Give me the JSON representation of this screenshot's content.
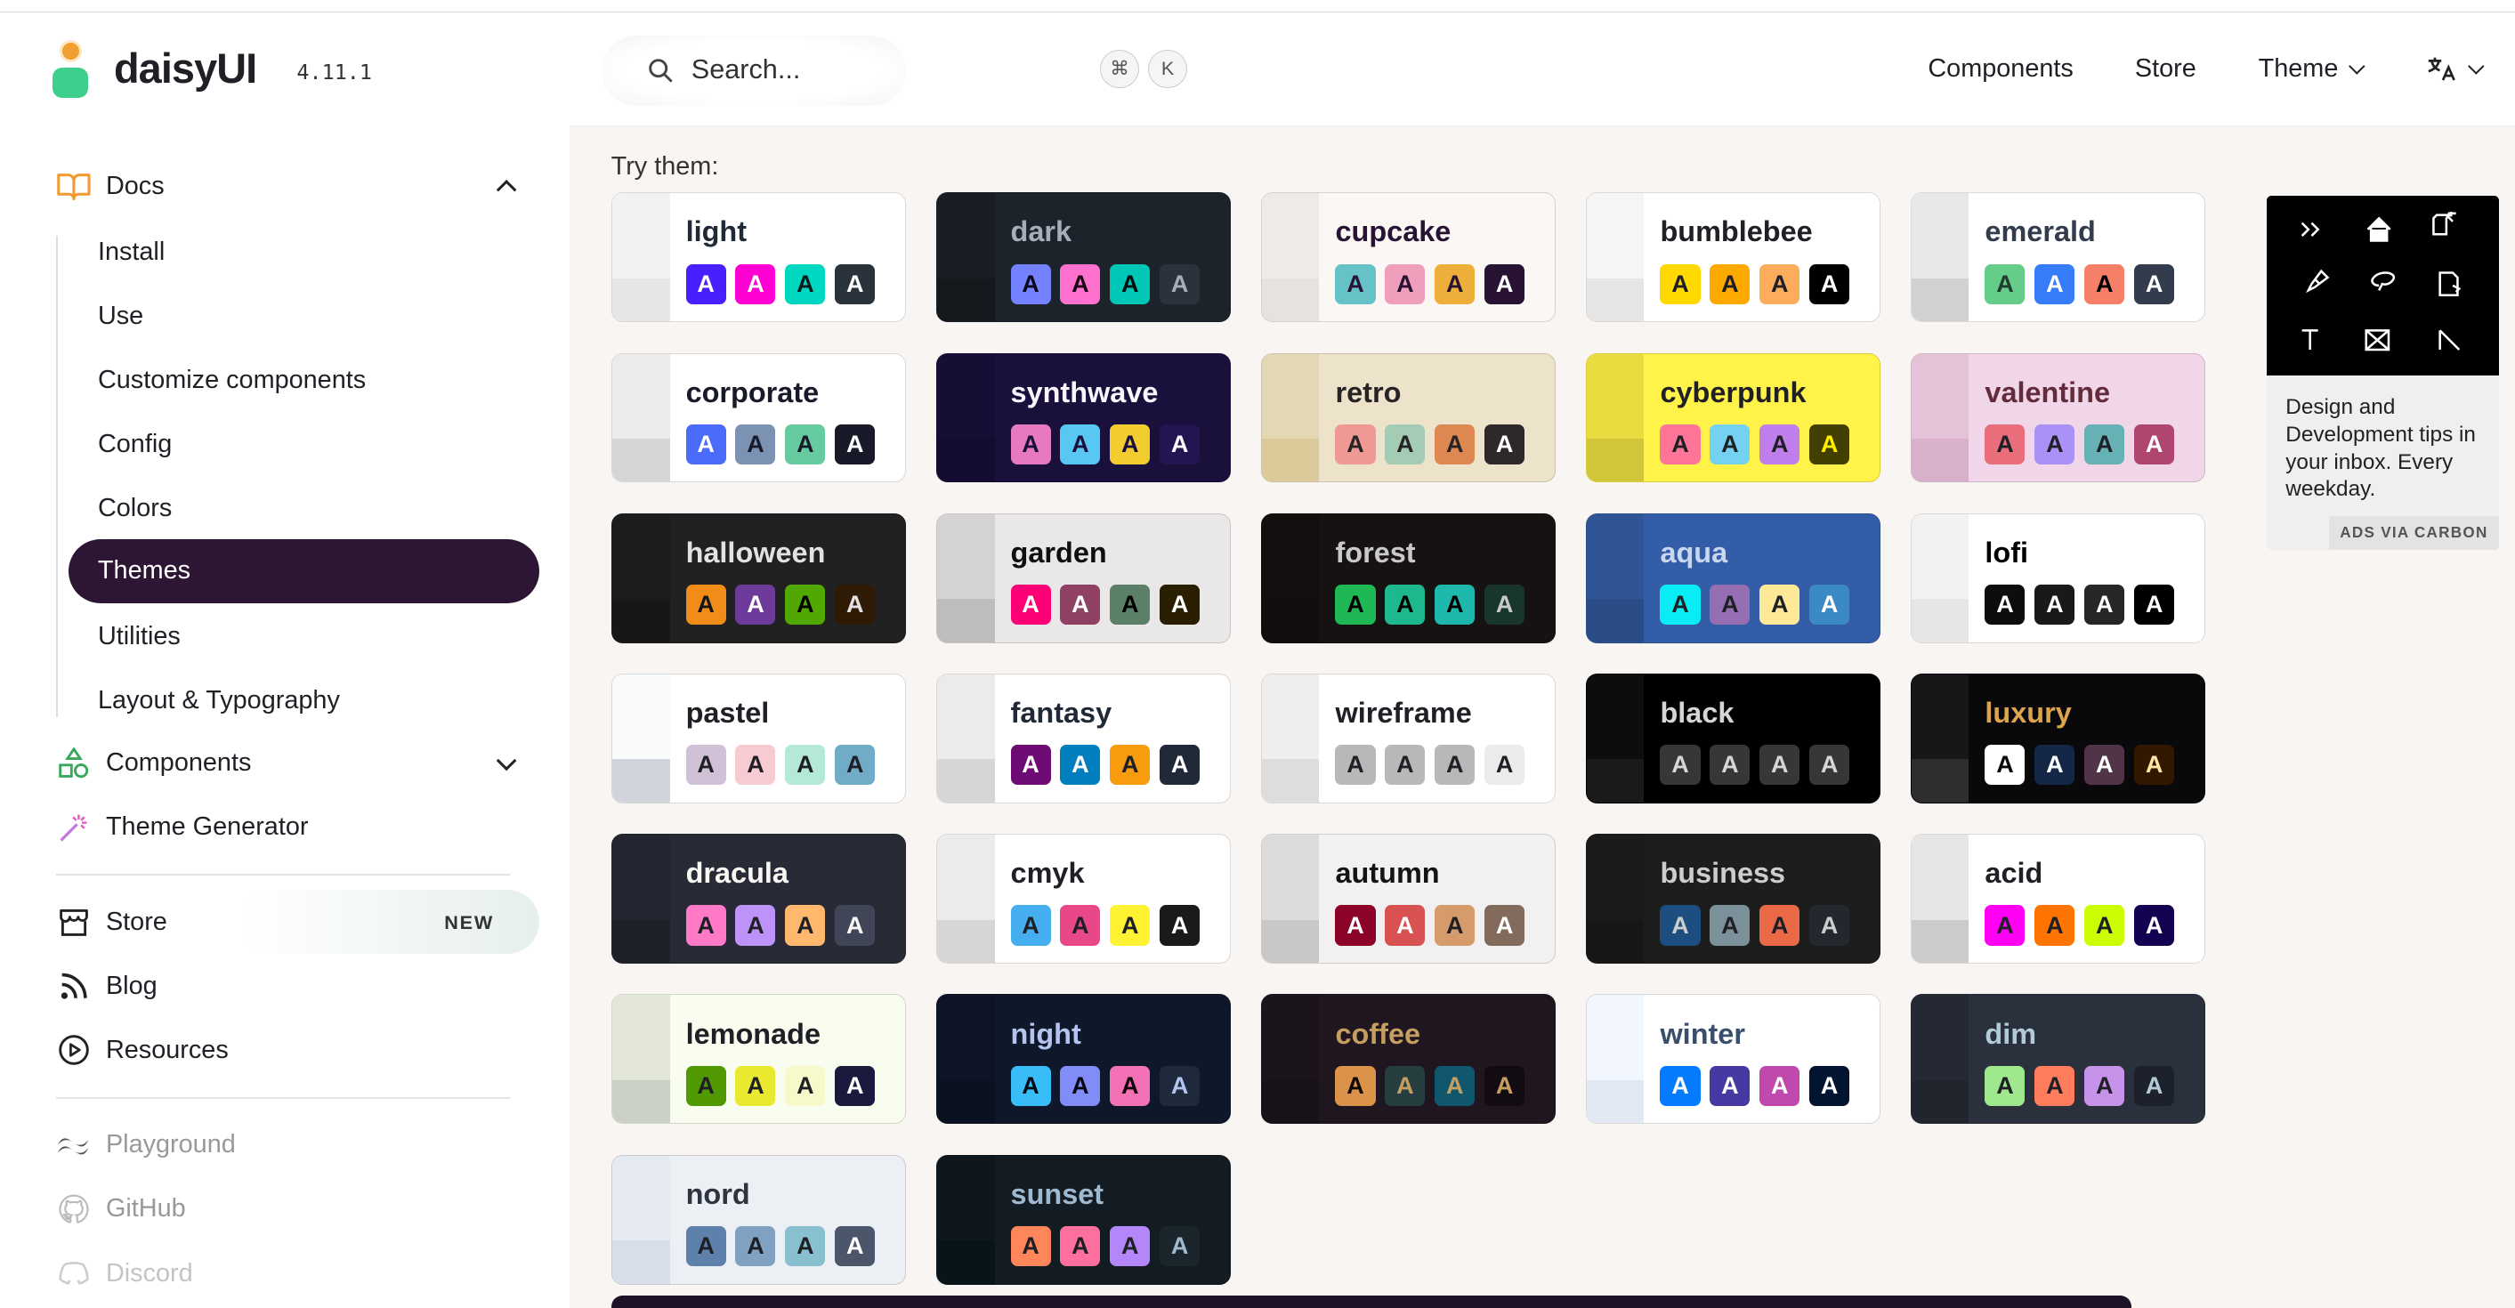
{
  "brand": {
    "name": "daisyUI",
    "version": "4.11.1"
  },
  "header": {
    "search_placeholder": "Search...",
    "kbd_cmd": "⌘",
    "kbd_k": "K",
    "links": {
      "components": "Components",
      "store": "Store",
      "theme": "Theme"
    }
  },
  "sidebar": {
    "docs": "Docs",
    "docs_items": [
      "Install",
      "Use",
      "Customize components",
      "Config",
      "Colors",
      "Themes",
      "Utilities",
      "Layout & Typography"
    ],
    "components": "Components",
    "theme_generator": "Theme Generator",
    "store": "Store",
    "store_badge": "NEW",
    "blog": "Blog",
    "resources": "Resources",
    "playground": "Playground",
    "github": "GitHub",
    "discord": "Discord"
  },
  "main": {
    "try_label": "Try them:"
  },
  "themes": [
    {
      "name": "light",
      "bg": "#ffffff",
      "s1": "#f2f2f2",
      "s2": "#e5e6e6",
      "fg": "#1f2937",
      "sw": [
        [
          "#491eff",
          "#fff"
        ],
        [
          "#ff00d3",
          "#fff"
        ],
        [
          "#00d7c0",
          "#0b1a18"
        ],
        [
          "#2a323c",
          "#fff"
        ]
      ]
    },
    {
      "name": "dark",
      "bg": "#1d232a",
      "s1": "#191e24",
      "s2": "#15191e",
      "fg": "#a6adbb",
      "sw": [
        [
          "#7582ff",
          "#050617"
        ],
        [
          "#ff71cf",
          "#190211"
        ],
        [
          "#00c7b5",
          "#000e0c"
        ],
        [
          "#2a323c",
          "#a6adbb"
        ]
      ]
    },
    {
      "name": "cupcake",
      "bg": "#faf7f5",
      "s1": "#efeae6",
      "s2": "#e7e2df",
      "fg": "#291334",
      "sw": [
        [
          "#65c3c8",
          "#291334"
        ],
        [
          "#ef9fbc",
          "#291334"
        ],
        [
          "#eeaf3a",
          "#291334"
        ],
        [
          "#291334",
          "#fff"
        ]
      ]
    },
    {
      "name": "bumblebee",
      "bg": "#ffffff",
      "s1": "#f5f5f5",
      "s2": "#e5e5e5",
      "fg": "#1f1f26",
      "sw": [
        [
          "#ffd900",
          "#1f1f26"
        ],
        [
          "#ffa800",
          "#1f1f26"
        ],
        [
          "#fbad5c",
          "#1f1f26"
        ],
        [
          "#000000",
          "#fff"
        ]
      ]
    },
    {
      "name": "emerald",
      "bg": "#ffffff",
      "s1": "#e8e8e8",
      "s2": "#d1d1d1",
      "fg": "#333c4d",
      "sw": [
        [
          "#66cc8a",
          "#223d30"
        ],
        [
          "#377cfb",
          "#fff"
        ],
        [
          "#f68067",
          "#000"
        ],
        [
          "#333c4d",
          "#fff"
        ]
      ]
    },
    {
      "name": "corporate",
      "bg": "#ffffff",
      "s1": "#ebebeb",
      "s2": "#d6d6d6",
      "fg": "#181a2a",
      "sw": [
        [
          "#4b6bfb",
          "#fff"
        ],
        [
          "#7b92b2",
          "#181a2a"
        ],
        [
          "#67cba0",
          "#181a2a"
        ],
        [
          "#181a2a",
          "#fff"
        ]
      ]
    },
    {
      "name": "synthwave",
      "bg": "#1a103c",
      "s1": "#170e36",
      "s2": "#140c30",
      "fg": "#f9f7fd",
      "sw": [
        [
          "#e779c1",
          "#1a103c"
        ],
        [
          "#58c7f3",
          "#1a103c"
        ],
        [
          "#f3cc30",
          "#1a103c"
        ],
        [
          "#221551",
          "#f9f7fd"
        ]
      ]
    },
    {
      "name": "retro",
      "bg": "#ece3ca",
      "s1": "#e4d8b4",
      "s2": "#dbca9a",
      "fg": "#282425",
      "sw": [
        [
          "#ef9995",
          "#282425"
        ],
        [
          "#a4cbb4",
          "#282425"
        ],
        [
          "#dc8850",
          "#282425"
        ],
        [
          "#2e282a",
          "#fff"
        ]
      ]
    },
    {
      "name": "cyberpunk",
      "bg": "#fff248",
      "s1": "#e8dc41",
      "s2": "#d1c63a",
      "fg": "#1f1f26",
      "sw": [
        [
          "#ff7598",
          "#1f1f26"
        ],
        [
          "#75d1f0",
          "#1f1f26"
        ],
        [
          "#c07eec",
          "#1f1f26"
        ],
        [
          "#423f00",
          "#ffee00"
        ]
      ]
    },
    {
      "name": "valentine",
      "bg": "#f0d6e8",
      "s1": "#e4c3d9",
      "s2": "#d9b0cb",
      "fg": "#632c3b",
      "sw": [
        [
          "#e96d7b",
          "#1f1f26"
        ],
        [
          "#a991f7",
          "#1f1f26"
        ],
        [
          "#66b1b3",
          "#1f1f26"
        ],
        [
          "#af4670",
          "#fff"
        ]
      ]
    },
    {
      "name": "halloween",
      "bg": "#212121",
      "s1": "#1c1c1c",
      "s2": "#171717",
      "fg": "#e2e2e2",
      "sw": [
        [
          "#f28c18",
          "#131616"
        ],
        [
          "#6d3a9c",
          "#fff"
        ],
        [
          "#51a800",
          "#000"
        ],
        [
          "#2f1b05",
          "#e2e2e2"
        ]
      ]
    },
    {
      "name": "garden",
      "bg": "#e9e7e7",
      "s1": "#d4d2d2",
      "s2": "#bfbcbc",
      "fg": "#100f0f",
      "sw": [
        [
          "#fe0075",
          "#fff"
        ],
        [
          "#8e4162",
          "#fff"
        ],
        [
          "#5c7f67",
          "#000"
        ],
        [
          "#291e00",
          "#fff"
        ]
      ]
    },
    {
      "name": "forest",
      "bg": "#171212",
      "s1": "#140f0f",
      "s2": "#110d0d",
      "fg": "#cac9c9",
      "sw": [
        [
          "#1eb854",
          "#000"
        ],
        [
          "#1db88e",
          "#000"
        ],
        [
          "#1db8ab",
          "#000"
        ],
        [
          "#19362d",
          "#cac9c9"
        ]
      ]
    },
    {
      "name": "aqua",
      "bg": "#345da7",
      "s1": "#2f5596",
      "s2": "#2a4c87",
      "fg": "#c8d6f0",
      "sw": [
        [
          "#09ecf3",
          "#1f1f26"
        ],
        [
          "#966fb3",
          "#1f1f26"
        ],
        [
          "#ffe999",
          "#1f1f26"
        ],
        [
          "#3b8ac4",
          "#fff"
        ]
      ]
    },
    {
      "name": "lofi",
      "bg": "#ffffff",
      "s1": "#f2f2f2",
      "s2": "#e6e6e6",
      "fg": "#000",
      "sw": [
        [
          "#0d0d0d",
          "#fff"
        ],
        [
          "#1a1919",
          "#fff"
        ],
        [
          "#262626",
          "#fff"
        ],
        [
          "#000000",
          "#fff"
        ]
      ]
    },
    {
      "name": "pastel",
      "bg": "#ffffff",
      "s1": "#f9fafb",
      "s2": "#d1d5db",
      "fg": "#1f1f26",
      "sw": [
        [
          "#d1c1d7",
          "#1f1f26"
        ],
        [
          "#f6cbd1",
          "#1f1f26"
        ],
        [
          "#b4e9d6",
          "#1f1f26"
        ],
        [
          "#70acc7",
          "#1f1f26"
        ]
      ]
    },
    {
      "name": "fantasy",
      "bg": "#ffffff",
      "s1": "#ebebeb",
      "s2": "#d6d6d6",
      "fg": "#1f2937",
      "sw": [
        [
          "#6e0b75",
          "#fff"
        ],
        [
          "#007ebd",
          "#fff"
        ],
        [
          "#f89c0e",
          "#1f1f26"
        ],
        [
          "#1f2937",
          "#fff"
        ]
      ]
    },
    {
      "name": "wireframe",
      "bg": "#ffffff",
      "s1": "#eeeeee",
      "s2": "#dddddd",
      "fg": "#1f1f26",
      "sw": [
        [
          "#b8b8b8",
          "#1f1f26"
        ],
        [
          "#b8b8b8",
          "#1f1f26"
        ],
        [
          "#b8b8b8",
          "#1f1f26"
        ],
        [
          "#ebebeb",
          "#1f1f26"
        ]
      ]
    },
    {
      "name": "black",
      "bg": "#000000",
      "s1": "#0d0d0d",
      "s2": "#1a1a1a",
      "fg": "#d6d6d6",
      "sw": [
        [
          "#373737",
          "#d6d6d6"
        ],
        [
          "#373737",
          "#d6d6d6"
        ],
        [
          "#373737",
          "#d6d6d6"
        ],
        [
          "#373737",
          "#d6d6d6"
        ]
      ]
    },
    {
      "name": "luxury",
      "bg": "#09090b",
      "s1": "#171618",
      "s2": "#2e2d2f",
      "fg": "#dca54c",
      "sw": [
        [
          "#ffffff",
          "#09090b"
        ],
        [
          "#152747",
          "#fff"
        ],
        [
          "#513448",
          "#fff"
        ],
        [
          "#331800",
          "#ffe7a3"
        ]
      ]
    },
    {
      "name": "dracula",
      "bg": "#282a36",
      "s1": "#232530",
      "s2": "#1e2029",
      "fg": "#f8f8f2",
      "sw": [
        [
          "#ff79c6",
          "#1f1f26"
        ],
        [
          "#bd93f9",
          "#1f1f26"
        ],
        [
          "#ffb86c",
          "#1f1f26"
        ],
        [
          "#414558",
          "#f8f8f2"
        ]
      ]
    },
    {
      "name": "cmyk",
      "bg": "#ffffff",
      "s1": "#ebebeb",
      "s2": "#d6d6d6",
      "fg": "#1f1f26",
      "sw": [
        [
          "#45aeee",
          "#1f1f26"
        ],
        [
          "#e8488a",
          "#1f1f26"
        ],
        [
          "#fff232",
          "#1f1f26"
        ],
        [
          "#1a1a1a",
          "#fff"
        ]
      ]
    },
    {
      "name": "autumn",
      "bg": "#f1f1f1",
      "s1": "#dcdcdc",
      "s2": "#c8c8c8",
      "fg": "#141414",
      "sw": [
        [
          "#8c0327",
          "#fff"
        ],
        [
          "#d85251",
          "#fff"
        ],
        [
          "#d59b6a",
          "#1f1f26"
        ],
        [
          "#826a5c",
          "#fff"
        ]
      ]
    },
    {
      "name": "business",
      "bg": "#1d1d1d",
      "s1": "#1a1a1a",
      "s2": "#171717",
      "fg": "#cdcdcd",
      "sw": [
        [
          "#1c4e80",
          "#cdcdcd"
        ],
        [
          "#7c909a",
          "#1f1f26"
        ],
        [
          "#ea6947",
          "#1f1f26"
        ],
        [
          "#23282e",
          "#cdcdcd"
        ]
      ]
    },
    {
      "name": "acid",
      "bg": "#ffffff",
      "s1": "#e6e6e6",
      "s2": "#cccccc",
      "fg": "#1f1f26",
      "sw": [
        [
          "#ff00f4",
          "#1f1f26"
        ],
        [
          "#ff7400",
          "#1f1f26"
        ],
        [
          "#cbfd03",
          "#1f1f26"
        ],
        [
          "#140152",
          "#fff"
        ]
      ]
    },
    {
      "name": "lemonade",
      "bg": "#f8fdef",
      "s1": "#e1e6d9",
      "s2": "#cbd0c4",
      "fg": "#1f1f26",
      "sw": [
        [
          "#519903",
          "#1f1f26"
        ],
        [
          "#e9e92f",
          "#1f1f26"
        ],
        [
          "#f7f9ca",
          "#1f1f26"
        ],
        [
          "#191a3e",
          "#fff"
        ]
      ]
    },
    {
      "name": "night",
      "bg": "#0f172a",
      "s1": "#0c1425",
      "s2": "#0a1120",
      "fg": "#b3c5ef",
      "sw": [
        [
          "#38bdf8",
          "#010d15"
        ],
        [
          "#818cf8",
          "#060713"
        ],
        [
          "#f471b5",
          "#14040c"
        ],
        [
          "#1e293b",
          "#b3c5ef"
        ]
      ]
    },
    {
      "name": "coffee",
      "bg": "#20161f",
      "s1": "#1c141b",
      "s2": "#171118",
      "fg": "#c59f60",
      "sw": [
        [
          "#db924b",
          "#110905"
        ],
        [
          "#263e3f",
          "#c59f60"
        ],
        [
          "#10576d",
          "#c59f60"
        ],
        [
          "#120c12",
          "#c59f60"
        ]
      ]
    },
    {
      "name": "winter",
      "bg": "#ffffff",
      "s1": "#f2f7ff",
      "s2": "#e3e9f4",
      "fg": "#394e6a",
      "sw": [
        [
          "#047aff",
          "#fff"
        ],
        [
          "#463aa2",
          "#fff"
        ],
        [
          "#c148ac",
          "#fff"
        ],
        [
          "#021431",
          "#fff"
        ]
      ]
    },
    {
      "name": "dim",
      "bg": "#2a303c",
      "s1": "#242933",
      "s2": "#20252e",
      "fg": "#b2ccd6",
      "sw": [
        [
          "#9fe88d",
          "#1f1f26"
        ],
        [
          "#ff7d5c",
          "#1f1f26"
        ],
        [
          "#c792e9",
          "#1f1f26"
        ],
        [
          "#1c212b",
          "#b2ccd6"
        ]
      ]
    },
    {
      "name": "nord",
      "bg": "#eceff4",
      "s1": "#e5e9f0",
      "s2": "#d8dee9",
      "fg": "#2e3440",
      "sw": [
        [
          "#5e81ac",
          "#1f1f26"
        ],
        [
          "#81a1c1",
          "#1f1f26"
        ],
        [
          "#88c0d0",
          "#1f1f26"
        ],
        [
          "#4c566a",
          "#fff"
        ]
      ]
    },
    {
      "name": "sunset",
      "bg": "#121c22",
      "s1": "#0e171e",
      "s2": "#09131a",
      "fg": "#9fb9d0",
      "sw": [
        [
          "#ff865b",
          "#1f1f26"
        ],
        [
          "#fd6f9c",
          "#1f1f26"
        ],
        [
          "#b387fa",
          "#1f1f26"
        ],
        [
          "#1b262c",
          "#9fb9d0"
        ]
      ]
    }
  ],
  "swatch_letter": "A",
  "ad": {
    "text": "Design and Development tips in your inbox. Every weekday.",
    "footer": "ADS VIA CARBON"
  }
}
